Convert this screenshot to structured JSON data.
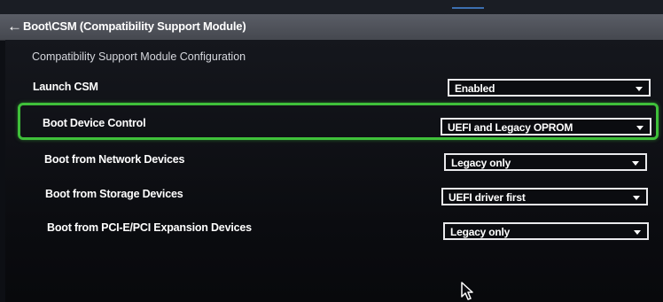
{
  "header": {
    "back_icon": "arrow-left-icon",
    "title": "Boot\\CSM (Compatibility Support Module)"
  },
  "section_title": "Compatibility Support Module Configuration",
  "settings": [
    {
      "label": "Launch CSM",
      "value": "Enabled"
    },
    {
      "label": "Boot Device Control",
      "value": "UEFI and Legacy OPROM",
      "highlighted": true
    },
    {
      "label": "Boot from Network Devices",
      "value": "Legacy only"
    },
    {
      "label": "Boot from Storage Devices",
      "value": "UEFI driver first"
    },
    {
      "label": "Boot from PCI-E/PCI Expansion Devices",
      "value": "Legacy only"
    }
  ],
  "colors": {
    "highlight_border": "#3fc03a",
    "header_bg": "#52555d",
    "panel_bg": "#0d0f14"
  },
  "icons": {
    "dropdown": "chevron-down-icon",
    "pointer": "mouse-pointer-icon"
  }
}
